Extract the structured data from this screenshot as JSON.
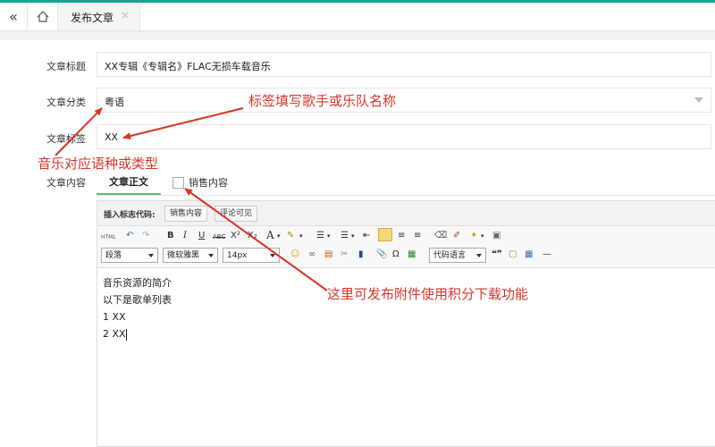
{
  "tabs": {
    "active": "发布文章",
    "close": "×"
  },
  "form": {
    "title_label": "文章标题",
    "title_value": "XX专辑《专辑名》FLAC无损车载音乐",
    "category_label": "文章分类",
    "category_value": "粤语",
    "tags_label": "文章标签",
    "tags_value": "XX",
    "content_label": "文章内容"
  },
  "content_tabs": {
    "main": "文章正文",
    "sale": "销售内容"
  },
  "insert_bar": {
    "label": "插入标志代码:",
    "buttons": [
      "销售内容",
      "评论可见"
    ]
  },
  "toolbar": {
    "html": "HTML",
    "paragraph": "段落",
    "font": "微软雅黑",
    "size": "14px",
    "code_lang": "代码语言",
    "glyphs": {
      "bold": "B",
      "italic": "I",
      "underline": "U",
      "strike": "ABC",
      "sup": "X²",
      "sub": "X₂",
      "fontcolor": "A",
      "quote": "❝❞",
      "omega": "Ω",
      "hr": "—"
    }
  },
  "editor_content": [
    "音乐资源的简介",
    "以下是歌单列表",
    "1 XX",
    "2 XX"
  ],
  "annotations": {
    "tag_hint": "标签填写歌手或乐队名称",
    "category_hint": "音乐对应语种或类型",
    "attach_hint": "这里可发布附件使用积分下载功能"
  },
  "colors": {
    "accent": "#17a589",
    "annotation": "#d9342b",
    "tab_underline": "#5fb878"
  }
}
